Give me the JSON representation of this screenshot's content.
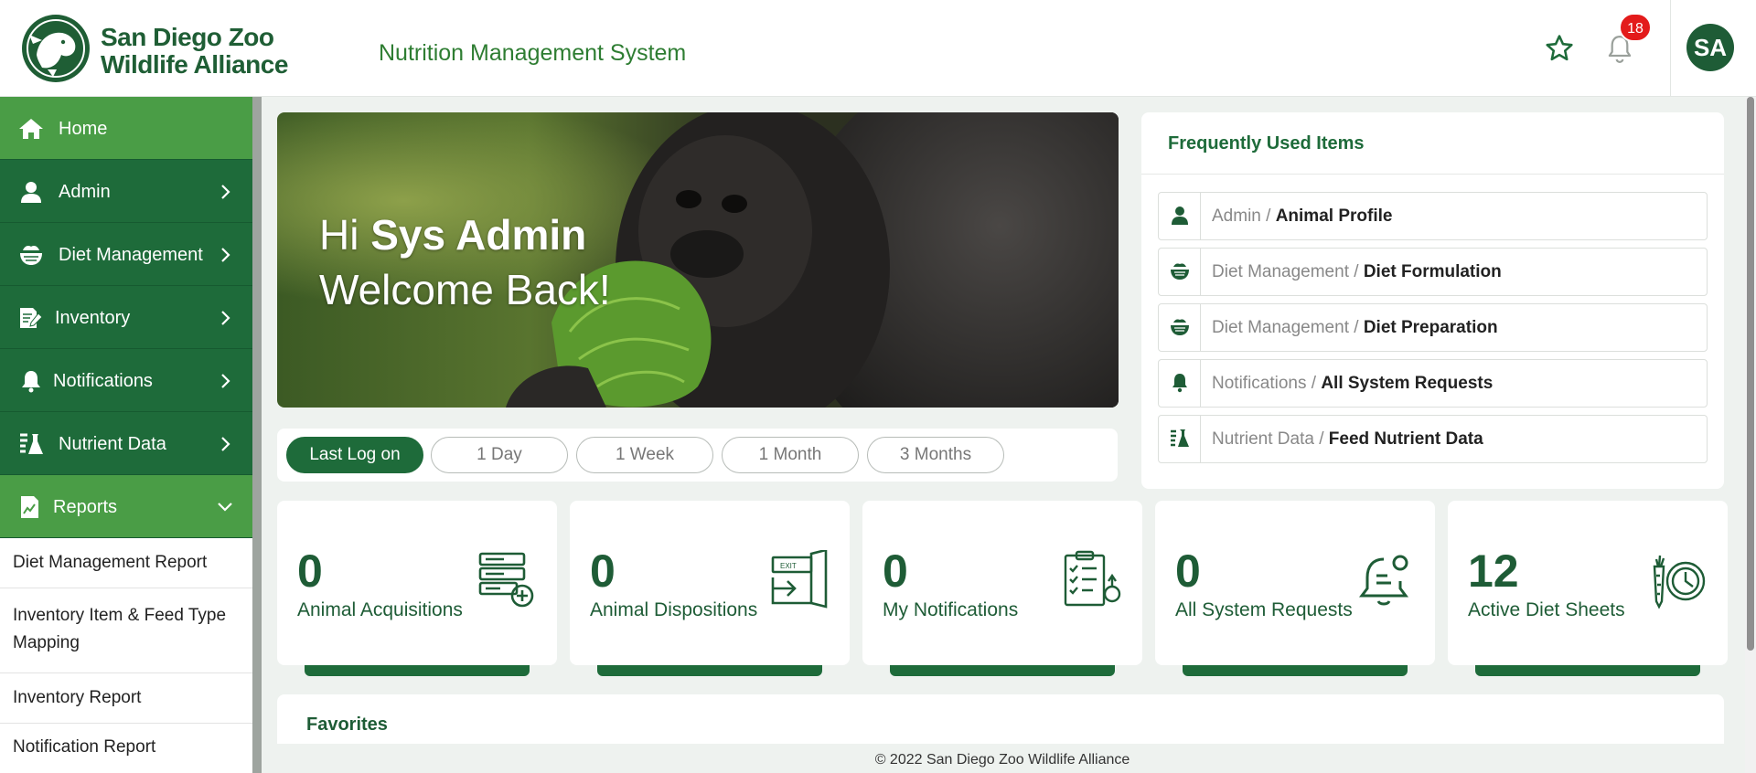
{
  "brand": {
    "line1": "San Diego Zoo",
    "line2": "Wildlife Alliance",
    "color": "#1f5e35"
  },
  "app": {
    "title": "Nutrition Management System"
  },
  "header": {
    "notification_count": "18",
    "user_initials": "SA",
    "icons": [
      "star-icon",
      "bell-icon"
    ]
  },
  "sidebar": {
    "items": [
      {
        "label": "Home",
        "icon": "home-icon",
        "active": true
      },
      {
        "label": "Admin",
        "icon": "user-icon"
      },
      {
        "label": "Diet Management",
        "icon": "food-bowl-icon"
      },
      {
        "label": "Inventory",
        "icon": "clipboard-edit-icon"
      },
      {
        "label": "Notifications",
        "icon": "bell-icon"
      },
      {
        "label": "Nutrient Data",
        "icon": "flask-list-icon"
      },
      {
        "label": "Reports",
        "icon": "report-chart-icon",
        "expanded": true
      }
    ],
    "report_subitems": [
      "Diet Management Report",
      "Inventory Item & Feed Type Mapping",
      "Inventory Report",
      "Notification Report"
    ]
  },
  "hero": {
    "greeting_prefix": "Hi",
    "user_name": "Sys Admin",
    "welcome": "Welcome Back!"
  },
  "log_filter": {
    "options": [
      "Last Log on",
      "1 Day",
      "1 Week",
      "1 Month",
      "3 Months"
    ],
    "selected": "Last Log on"
  },
  "frequent": {
    "title": "Frequently Used Items",
    "items": [
      {
        "section": "Admin / ",
        "page": "Animal Profile",
        "icon": "user-icon"
      },
      {
        "section": "Diet Management / ",
        "page": "Diet Formulation",
        "icon": "food-bowl-icon"
      },
      {
        "section": "Diet Management / ",
        "page": "Diet Preparation",
        "icon": "food-bowl-icon"
      },
      {
        "section": "Notifications / ",
        "page": "All System Requests",
        "icon": "bell-icon"
      },
      {
        "section": "Nutrient Data / ",
        "page": "Feed Nutrient Data",
        "icon": "flask-list-icon"
      }
    ]
  },
  "stats": [
    {
      "value": "0",
      "label": "Animal Acquisitions",
      "icon": "server-add-icon"
    },
    {
      "value": "0",
      "label": "Animal Dispositions",
      "icon": "exit-door-icon"
    },
    {
      "value": "0",
      "label": "My Notifications",
      "icon": "checklist-icon"
    },
    {
      "value": "0",
      "label": "All System Requests",
      "icon": "notification-bell-icon"
    },
    {
      "value": "12",
      "label": "Active Diet Sheets",
      "icon": "carrot-clock-icon"
    }
  ],
  "favorites": {
    "title": "Favorites"
  },
  "footer": {
    "text": "© 2022 San Diego Zoo Wildlife Alliance"
  },
  "colors": {
    "primary": "#1e6b3a",
    "active_nav": "#4a9d46",
    "title_green": "#2e7d32",
    "badge_red": "#e31b1b"
  }
}
